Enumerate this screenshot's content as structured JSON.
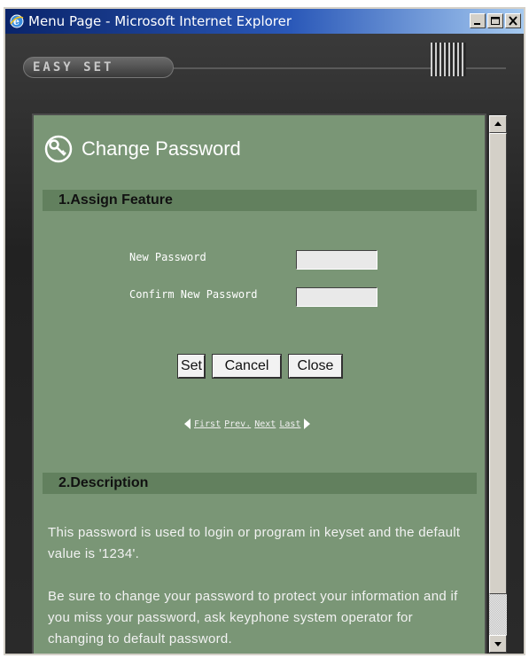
{
  "window": {
    "title": "Menu Page - Microsoft Internet Explorer",
    "icon": "ie-icon",
    "controls": [
      "minimize-icon",
      "maximize-icon",
      "close-icon"
    ]
  },
  "frame": {
    "logo": "EASY SET"
  },
  "page": {
    "title": "Change Password",
    "title_icon": "key-icon"
  },
  "section1": {
    "header": "1.Assign Feature",
    "new_password_label": "New Password",
    "confirm_password_label": "Confirm New Password",
    "new_password_value": "",
    "confirm_password_value": ""
  },
  "buttons": {
    "set": "Set",
    "cancel": "Cancel",
    "close": "Close"
  },
  "pager": {
    "first": "First",
    "prev": "Prev.",
    "next": "Next",
    "last": "Last"
  },
  "section2": {
    "header": "2.Description",
    "paragraph1": "This password is used to login or program in keyset and the default value is '1234'.",
    "paragraph2": "Be sure to change your password to protect your information and if you miss your password, ask keyphone system operator for changing to default password."
  },
  "colors": {
    "panel": "#7a9676",
    "section_bar": "#62805e",
    "titlebar_start": "#0a246a"
  }
}
